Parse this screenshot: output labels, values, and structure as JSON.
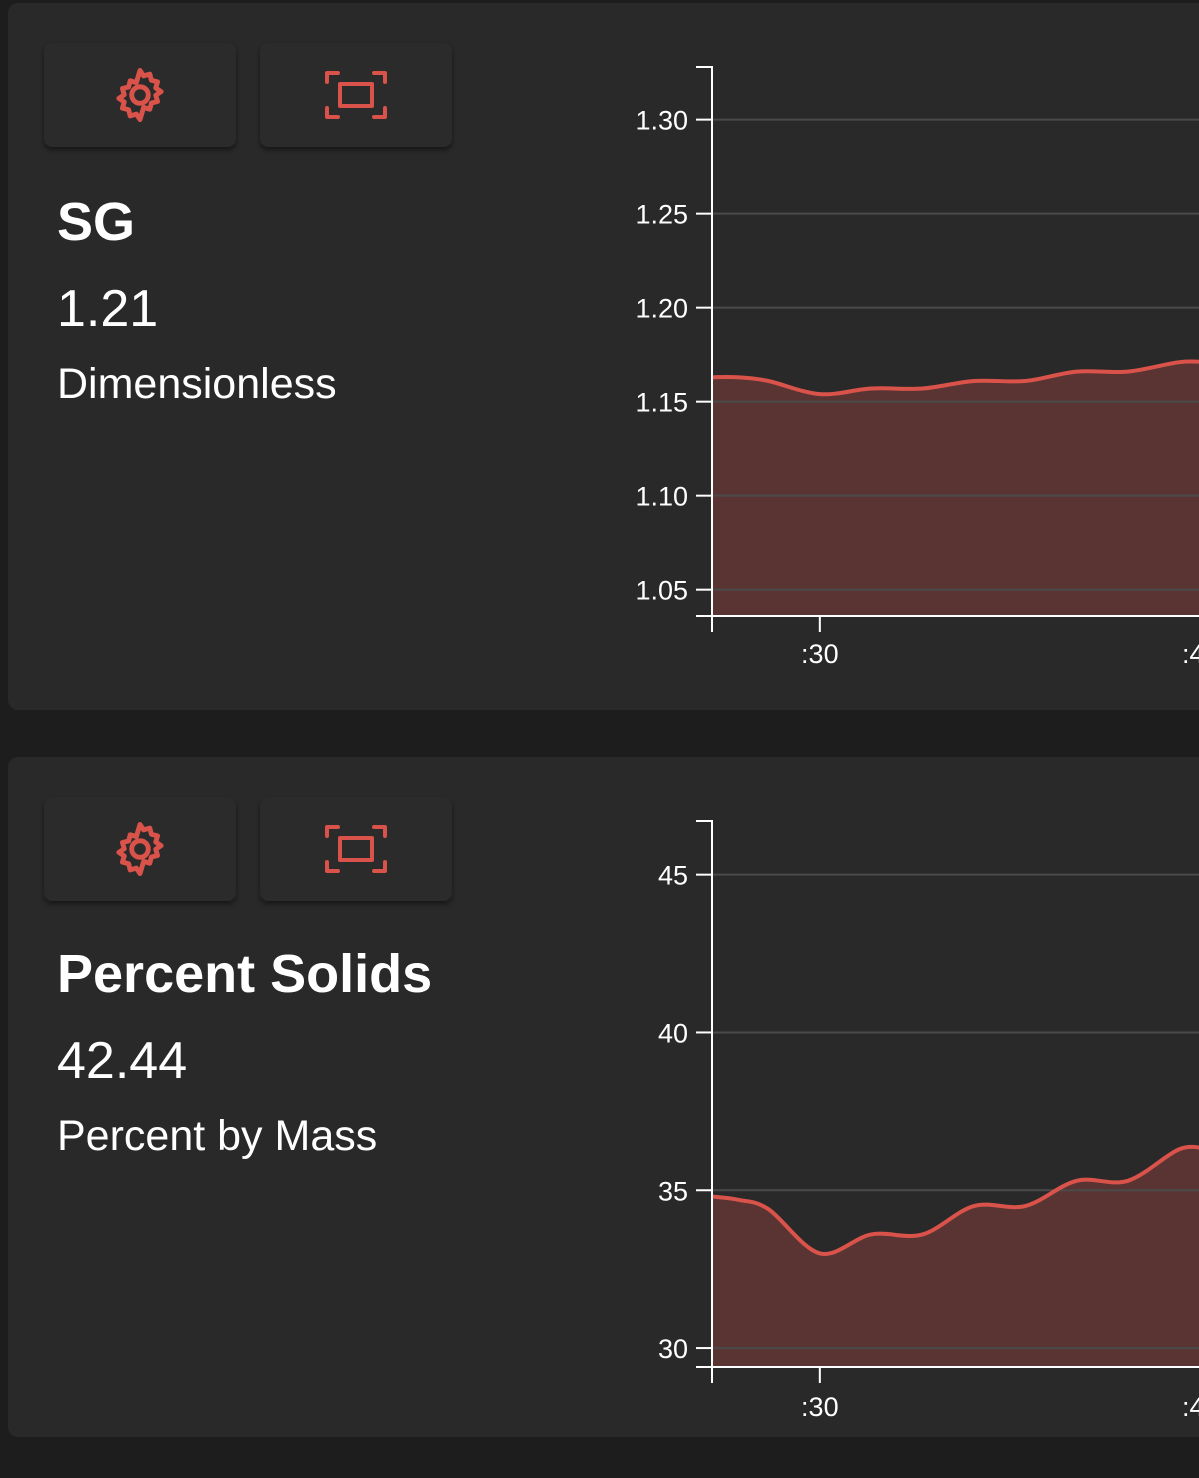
{
  "theme": {
    "accent": "#d9534a",
    "card_bg": "#292929",
    "page_bg": "#1d1d1d",
    "area_fill": "#5a3433"
  },
  "cards": [
    {
      "settings_icon": "gear-icon",
      "fullscreen_icon": "fullscreen-icon",
      "name": "SG",
      "value": "1.21",
      "unit": "Dimensionless"
    },
    {
      "settings_icon": "gear-icon",
      "fullscreen_icon": "fullscreen-icon",
      "name": "Percent Solids",
      "value": "42.44",
      "unit": "Percent by Mass"
    }
  ],
  "chart_data": [
    {
      "type": "area",
      "y_ticks": [
        "1.30",
        "1.25",
        "1.20",
        "1.15",
        "1.10",
        "1.05"
      ],
      "y_tick_values": [
        1.3,
        1.25,
        1.2,
        1.15,
        1.1,
        1.05
      ],
      "ylim": [
        1.036,
        1.328
      ],
      "x_tick_labels": [
        ":30",
        ":4"
      ],
      "x_tick_values": [
        30,
        40
      ],
      "xlim": [
        28.95,
        33.78
      ],
      "grid": true,
      "x": [
        28.95,
        29.2,
        29.5,
        30.0,
        30.5,
        31.0,
        31.5,
        32.0,
        32.5,
        33.0,
        33.5,
        33.78
      ],
      "y": [
        1.163,
        1.163,
        1.161,
        1.154,
        1.157,
        1.157,
        1.161,
        1.161,
        1.166,
        1.166,
        1.171,
        1.171
      ]
    },
    {
      "type": "area",
      "y_ticks": [
        "45",
        "40",
        "35",
        "30"
      ],
      "y_tick_values": [
        45,
        40,
        35,
        30
      ],
      "ylim": [
        29.4,
        46.7
      ],
      "x_tick_labels": [
        ":30",
        ":4"
      ],
      "x_tick_values": [
        30,
        40
      ],
      "xlim": [
        28.95,
        33.78
      ],
      "grid": true,
      "x": [
        28.95,
        29.2,
        29.5,
        30.0,
        30.5,
        31.0,
        31.5,
        32.0,
        32.5,
        33.0,
        33.5,
        33.78
      ],
      "y": [
        34.8,
        34.7,
        34.4,
        33.0,
        33.6,
        33.6,
        34.5,
        34.5,
        35.3,
        35.3,
        36.3,
        36.3
      ]
    }
  ]
}
